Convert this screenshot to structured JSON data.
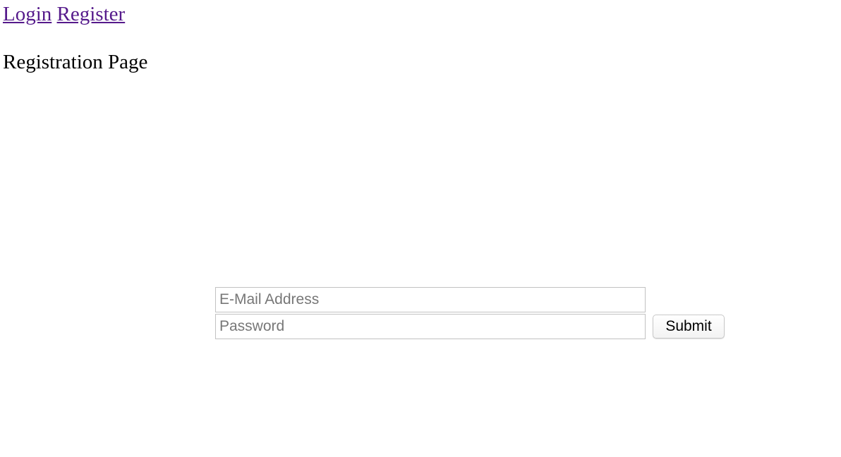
{
  "nav": {
    "links": [
      {
        "label": "Login"
      },
      {
        "label": "Register"
      }
    ],
    "link_color": "#551a8b"
  },
  "page": {
    "title": "Registration Page"
  },
  "form": {
    "email": {
      "placeholder": "E-Mail Address",
      "value": ""
    },
    "password": {
      "placeholder": "Password",
      "value": ""
    },
    "submit_label": "Submit"
  }
}
